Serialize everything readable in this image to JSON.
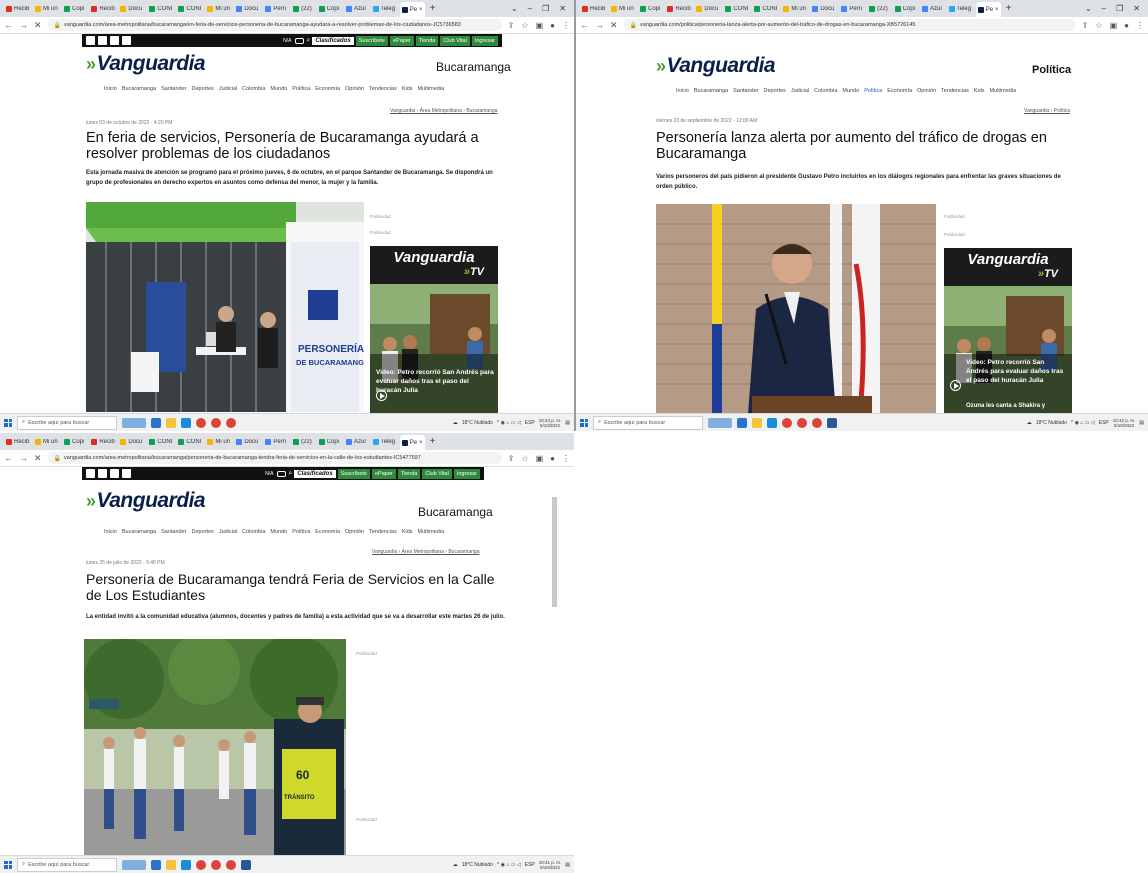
{
  "browser": {
    "tabs": [
      "Recib",
      "Mi un",
      "Copi",
      "Recib",
      "Docu",
      "CONI",
      "CONI",
      "Mi un",
      "Docu",
      "Perri",
      "(22)",
      "Copi",
      "Azul",
      "Teleg",
      "Pe"
    ],
    "w1_url": "vanguardia.com/area-metropolitana/bucaramanga/en-feria-de-servicios-personeria-de-bucaramanga-ayudara-a-resolver-problemas-de-los-ciudadanos-JC5736583",
    "w2_url": "vanguardia.com/politica/personeria-lanza-alerta-por-aumento-del-trafico-de-drogas-en-bucaramanga-XB5726145",
    "w3_url": "vanguardia.com/area-metropolitana/bucaramanga/personeria-de-bucaramanga-tendra-feria-de-servicios-en-la-calle-de-los-estudiantes-IC5477597"
  },
  "site": {
    "logo": "Vanguardia",
    "na": "N/A",
    "clasificados": "Clasificados",
    "buttons": [
      "Suscríbete",
      "ePaper",
      "Tienda",
      "Club Vital",
      "Ingresar"
    ],
    "menu": [
      "Inicio",
      "Bucaramanga",
      "Santander",
      "Deportes",
      "Judicial",
      "Colombia",
      "Mundo",
      "Política",
      "Economía",
      "Opinión",
      "Tendencias",
      "Kids",
      "Multimedia"
    ]
  },
  "articles": [
    {
      "section": "Bucaramanga",
      "crumb": "Vanguardia › Área Metropolitana › Bucaramanga",
      "date": "lunes 03 de octubre de 2022 - 4:20 PM",
      "title": "En feria de servicios, Personería de Bucaramanga ayudará a resolver problemas de los ciudadanos",
      "lead": "Esta jornada masiva de atención se programó para el próximo jueves, 6 de octubre, en el parque Santander de Bucaramanga. Se dispondrá un grupo de profesionales en derecho expertos en asuntos como defensa del menor, la mujer y la familia.",
      "pub": "Publicidad",
      "photo_sign": "PERSONERÍA DE BUCARAMANGA",
      "video_caption": "Video: Petro recorrió San Andrés para evaluar daños tras el paso del huracán Julia"
    },
    {
      "section": "Política",
      "crumb": "Vanguardia › Política",
      "date": "viernes 23 de septiembre de 2022 - 12:00 AM",
      "title": "Personería lanza alerta por aumento del tráfico de drogas en Bucaramanga",
      "lead": "Varios personeros del país pidieron al presidente Gustavo Petro incluirlos en los diálogos regionales para enfrentar las graves situaciones de orden público.",
      "pub": "Publicidad",
      "video_caption": "Video: Petro recorrió San Andrés para evaluar daños tras el paso del huracán Julia",
      "video_caption2": "Ozuna les canta a Shakira y"
    },
    {
      "section": "Bucaramanga",
      "crumb": "Vanguardia › Área Metropolitana › Bucaramanga",
      "date": "lunes 25 de julio de 2022 - 9:45 PM",
      "title": "Personería de Bucaramanga tendrá Feria de Servicios en la Calle de Los Estudiantes",
      "lead": "La entidad invitó a la comunidad educativa (alumnos, docentes y padres de familia) a esta actividad que se va a desarrollar este martes 26 de julio.",
      "pub": "Publicidad",
      "vest": "TRÁNSITO"
    }
  ],
  "tv": {
    "vanguardia": "Vanguardia",
    "tv": "TV"
  },
  "taskbar": {
    "search": "Escribe aquí para buscar",
    "weather": "18°C Nublado",
    "lang": "ESP",
    "clock1": [
      "10:44 p. m.",
      "5/10/2022"
    ],
    "clock2": [
      "10:42 p. m.",
      "5/10/2022"
    ],
    "clock3": [
      "10:41 p. m.",
      "5/10/2022"
    ]
  },
  "colors": {
    "navy": "#0b1f4b",
    "green": "#4a9a2e",
    "btn": "#2f8a3c"
  }
}
